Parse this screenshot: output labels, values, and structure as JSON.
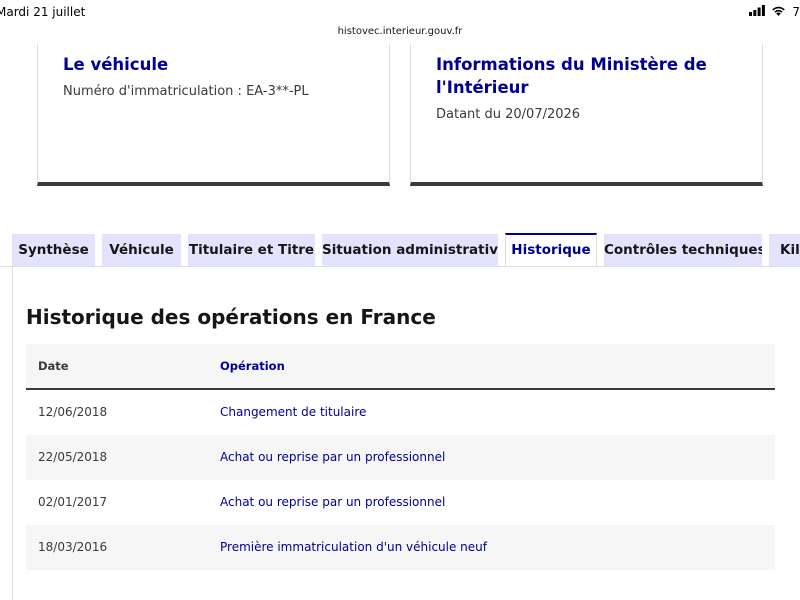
{
  "statusbar": {
    "date": "Mardi 21 juillet",
    "battery": "7",
    "url": "histovec.interieur.gouv.fr"
  },
  "cards": {
    "vehicle": {
      "title": "Le véhicule",
      "subtitle": "Numéro d'immatriculation : EA-3**-PL"
    },
    "ministry": {
      "title": "Informations du Ministère de l'Intérieur",
      "subtitle": "Datant du 20/07/2026"
    }
  },
  "tabs": [
    {
      "label": "Synthèse",
      "active": false
    },
    {
      "label": "Véhicule",
      "active": false
    },
    {
      "label": "Titulaire et Titre",
      "active": false
    },
    {
      "label": "Situation administrative",
      "active": false
    },
    {
      "label": "Historique",
      "active": true
    },
    {
      "label": "Contrôles techniques",
      "active": false
    },
    {
      "label": "Kilo",
      "active": false
    }
  ],
  "panel": {
    "title": "Historique des opérations en France",
    "columns": {
      "date": "Date",
      "operation": "Opération"
    },
    "rows": [
      {
        "date": "12/06/2018",
        "operation": "Changement de titulaire"
      },
      {
        "date": "22/05/2018",
        "operation": "Achat ou reprise par un professionnel"
      },
      {
        "date": "02/01/2017",
        "operation": "Achat ou reprise par un professionnel"
      },
      {
        "date": "18/03/2016",
        "operation": "Première immatriculation d'un véhicule neuf"
      }
    ]
  },
  "colors": {
    "primary": "#000091",
    "tab_bg": "#e3e3fd",
    "row_alt": "#f6f6f6"
  }
}
